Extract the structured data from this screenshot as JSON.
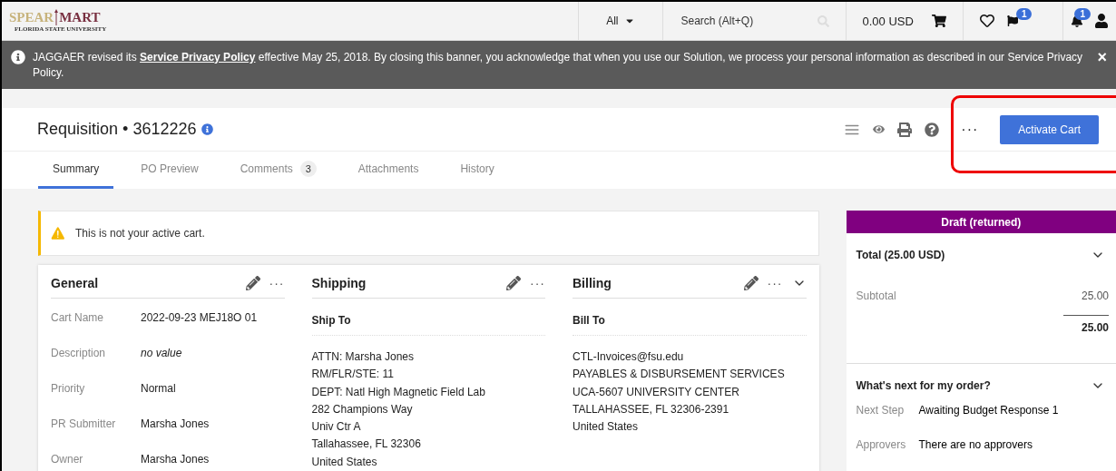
{
  "header": {
    "logo": {
      "left": "SPEAR",
      "right": "MART",
      "subtitle": "FLORIDA STATE UNIVERSITY"
    },
    "scope": "All",
    "search": {
      "placeholder": "Search (Alt+Q)"
    },
    "cart_total": "0.00 USD",
    "flag_count": "1",
    "notification_count": "1"
  },
  "banner": {
    "before": "JAGGAER revised its",
    "link": "Service Privacy Policy",
    "after": "effective May 25, 2018. By closing this banner, you acknowledge that when you use our Solution, we process your personal information as described in our Service Privacy Policy.",
    "close": "×"
  },
  "title": {
    "label": "Requisition",
    "separator": "•",
    "number": "3612226"
  },
  "more": "···",
  "primary_button": "Activate Cart",
  "highlighted": true,
  "tabs": [
    {
      "label": "Summary",
      "selected": true
    },
    {
      "label": "PO Preview",
      "selected": false
    },
    {
      "label": "Comments",
      "count": "3",
      "selected": false
    },
    {
      "label": "Attachments",
      "selected": false
    },
    {
      "label": "History",
      "selected": false
    }
  ],
  "alert": "This is not your active cart.",
  "general": {
    "title": "General",
    "more": "···",
    "fields": [
      {
        "label": "Cart Name",
        "value": "2022-09-23 MEJ18O 01",
        "empty": false
      },
      {
        "label": "Description",
        "value": "no value",
        "empty": true
      },
      {
        "label": "Priority",
        "value": "Normal",
        "empty": false
      },
      {
        "label": "PR Submitter",
        "value": "Marsha Jones",
        "empty": false
      },
      {
        "label": "Owner",
        "value": "Marsha Jones",
        "empty": false
      }
    ]
  },
  "shipping": {
    "title": "Shipping",
    "more": "···",
    "subtitle": "Ship To",
    "lines": [
      "ATTN: Marsha Jones",
      "RM/FLR/STE: 11",
      "DEPT: Natl High Magnetic Field Lab",
      "282 Champions Way",
      "Univ Ctr A",
      "Tallahassee, FL 32306",
      "United States"
    ]
  },
  "billing": {
    "title": "Billing",
    "more": "···",
    "subtitle": "Bill To",
    "lines": [
      "CTL-Invoices@fsu.edu",
      "PAYABLES & DISBURSEMENT SERVICES",
      "UCA-5607 UNIVERSITY CENTER",
      "TALLAHASSEE, FL 32306-2391",
      "United States"
    ]
  },
  "summary": {
    "status": "Draft (returned)",
    "total_title": "Total (25.00 USD)",
    "subtotal_label": "Subtotal",
    "subtotal": "25.00",
    "total": "25.00",
    "next_title": "What's next for my order?",
    "next": [
      {
        "label": "Next Step",
        "value": "Awaiting Budget Response 1"
      },
      {
        "label": "Approvers",
        "value": "There are no approvers"
      }
    ]
  }
}
